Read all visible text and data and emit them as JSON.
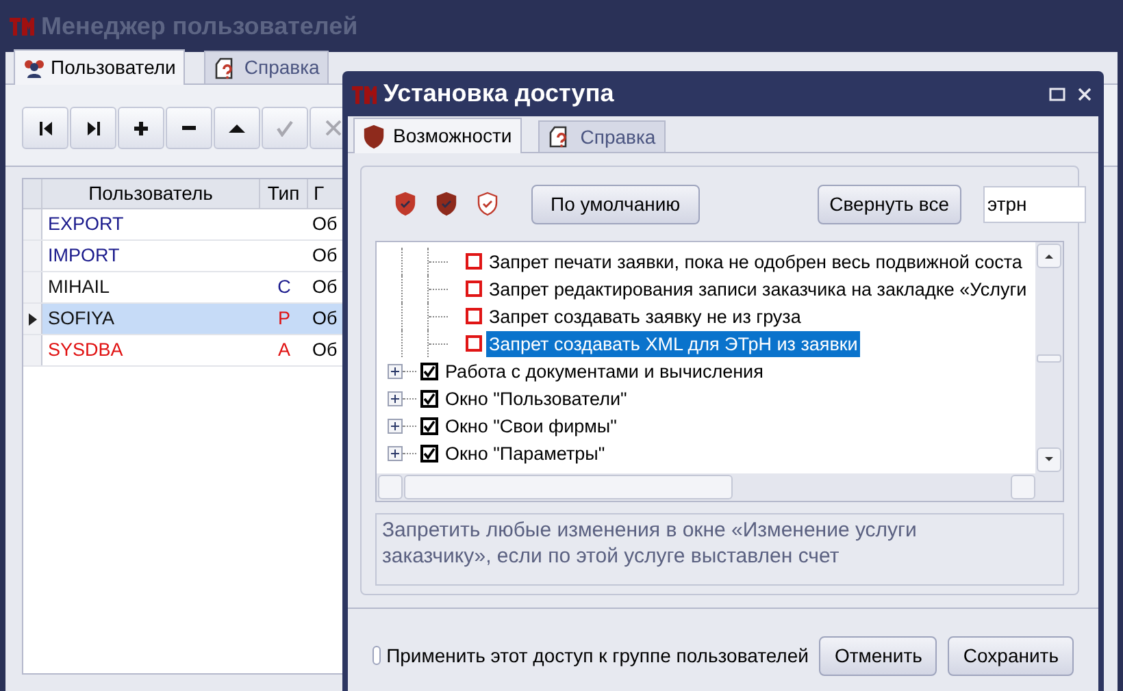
{
  "main_window": {
    "title": "Менеджер пользователей",
    "active": false
  },
  "main_tabs": [
    {
      "label": "Пользователи",
      "kind": "users",
      "selected": true
    },
    {
      "label": "Справка",
      "kind": "help",
      "selected": false
    }
  ],
  "toolbar": [
    {
      "kind": "first",
      "disabled": false
    },
    {
      "kind": "last",
      "disabled": false
    },
    {
      "kind": "add",
      "disabled": false
    },
    {
      "kind": "remove",
      "disabled": false
    },
    {
      "kind": "up",
      "disabled": false
    },
    {
      "kind": "apply",
      "disabled": true
    },
    {
      "kind": "cancel",
      "disabled": true
    }
  ],
  "table": {
    "columns": [
      "Пользователь",
      "Тип",
      "Г"
    ],
    "rows": [
      {
        "user": "EXPORT",
        "group": "Об",
        "kind": "system",
        "selected": false
      },
      {
        "user": "IMPORT",
        "group": "Об",
        "kind": "system",
        "selected": false
      },
      {
        "user": "MIHAIL",
        "type": {
          "text": "С",
          "kind": "limited"
        },
        "group": "Об",
        "kind": "regular",
        "selected": false
      },
      {
        "user": "SOFIYA",
        "type": {
          "text": "Р",
          "kind": "privileged"
        },
        "group": "Об",
        "kind": "regular",
        "selected": true
      },
      {
        "user": "SYSDBA",
        "type": {
          "text": "А",
          "kind": "privileged"
        },
        "group": "Об",
        "kind": "admin",
        "selected": false
      }
    ]
  },
  "dialog": {
    "title": "Установка доступа",
    "tabs": [
      {
        "label": "Возможности",
        "kind": "shield",
        "selected": true
      },
      {
        "label": "Справка",
        "kind": "help",
        "selected": false
      }
    ],
    "shield_buttons": [
      {
        "kind": "full"
      },
      {
        "kind": "dark"
      },
      {
        "kind": "outline"
      }
    ],
    "default_button": "По умолчанию",
    "collapse_button": "Свернуть все",
    "search": {
      "value": "этрн"
    },
    "tree": [
      {
        "label": "Запрет печати заявки, пока не одобрен весь подвижной соста",
        "kind": "restriction",
        "checked": false,
        "selected": false
      },
      {
        "label": "Запрет редактирования записи заказчика на закладке «Услуги",
        "kind": "restriction",
        "checked": false,
        "selected": false
      },
      {
        "label": "Запрет создавать заявку не из груза",
        "kind": "restriction",
        "checked": false,
        "selected": false
      },
      {
        "label": "Запрет создавать XML для ЭТрН из заявки",
        "kind": "restriction",
        "checked": false,
        "selected": true
      },
      {
        "label": "Работа с документами и вычисления",
        "kind": "group",
        "checked": true,
        "selected": false,
        "expanded": false
      },
      {
        "label": "Окно \"Пользователи\"",
        "kind": "group",
        "checked": true,
        "selected": false,
        "expanded": false
      },
      {
        "label": "Окно \"Свои фирмы\"",
        "kind": "group",
        "checked": true,
        "selected": false,
        "expanded": false
      },
      {
        "label": "Окно \"Параметры\"",
        "kind": "group",
        "checked": true,
        "selected": false,
        "expanded": false
      }
    ],
    "description": "Запретить любые изменения в окне «Изменение услуги заказчику», если по этой услуге выставлен счет",
    "apply_group": {
      "label": "Применить этот доступ к группе пользователей",
      "checked": false
    },
    "buttons": [
      "Отменить",
      "Сохранить"
    ]
  }
}
